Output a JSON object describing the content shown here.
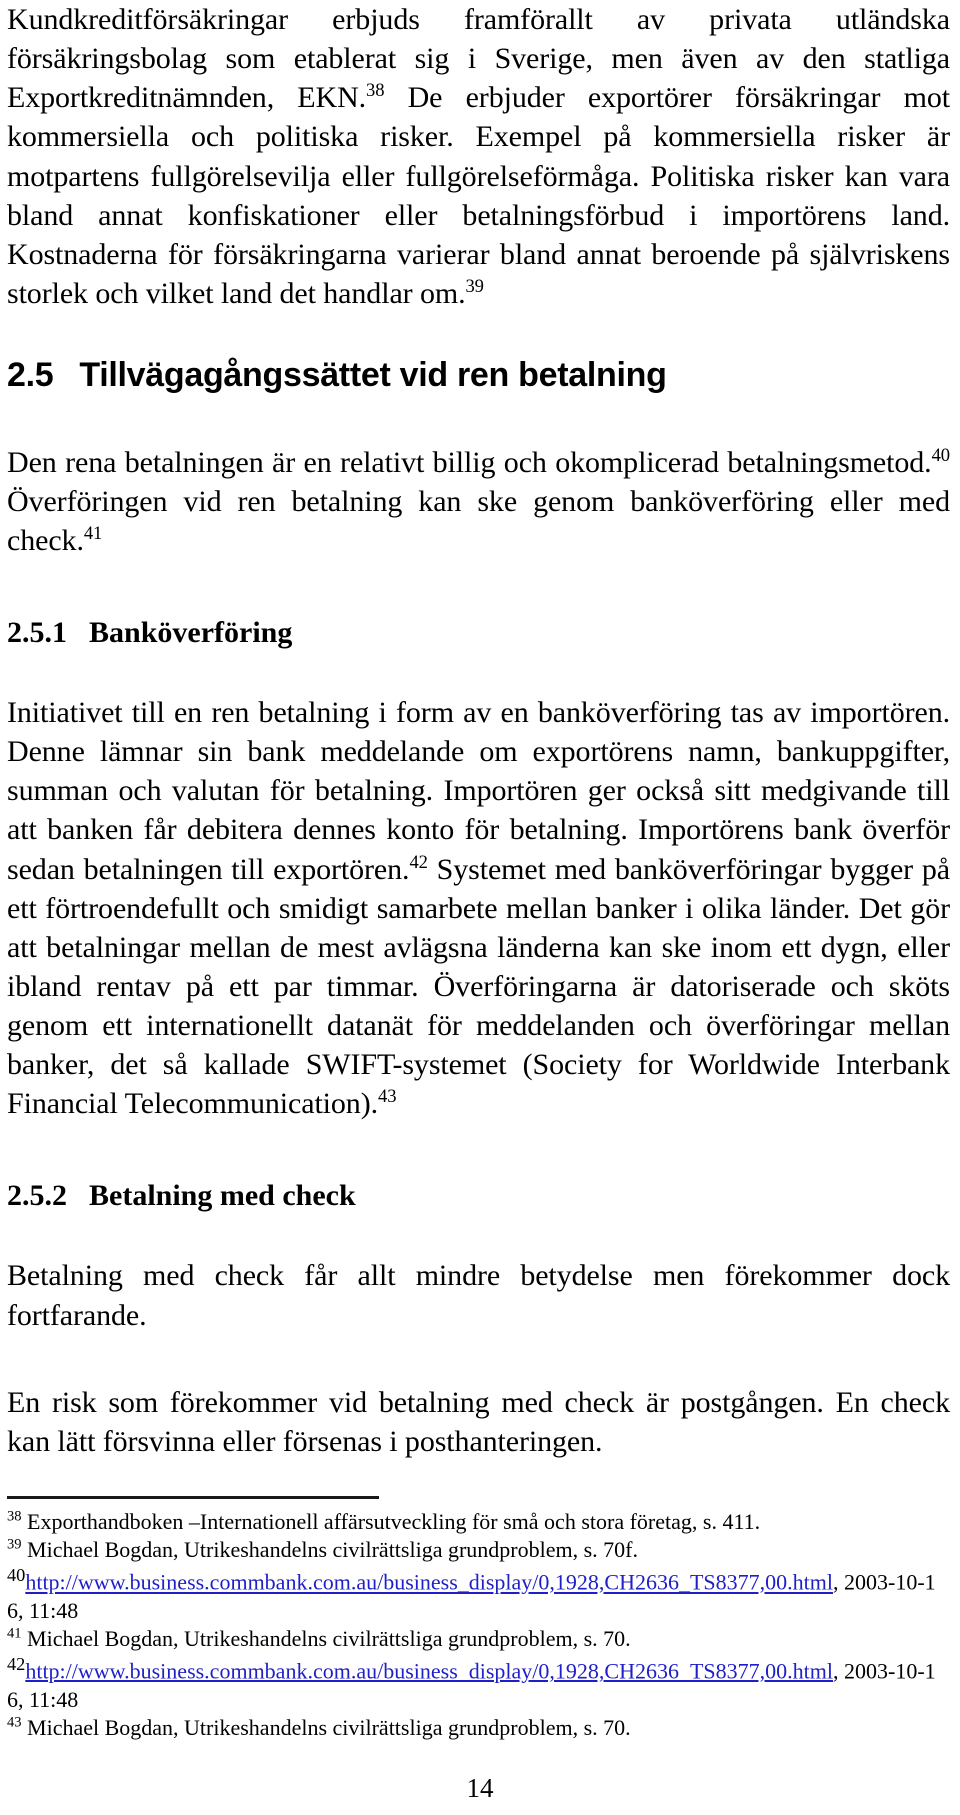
{
  "document": {
    "language": "sv",
    "page_number": "14"
  },
  "paragraphs": {
    "p1": {
      "text_before_ref1": "Kundkreditförsäkringar erbjuds framförallt av privata utländska försäkringsbolag som etablerat sig i Sverige, men även av den statliga Exportkreditnämnden, EKN.",
      "ref1": "38",
      "text_after_ref1": " De erbjuder exportörer försäkringar mot kommersiella och politiska risker. Exempel på kommersiella risker är motpartens fullgörelsevilja eller fullgörelseförmåga. Politiska risker kan vara bland annat konfiskationer eller betalningsförbud i importörens land. Kostnaderna för försäkringarna varierar bland annat beroende på självriskens storlek och vilket land det handlar om.",
      "ref2": "39"
    },
    "p2": {
      "text_before_ref1": "Den rena betalningen är en relativt billig och okomplicerad betalningsmetod.",
      "ref1": "40",
      "text_after_ref1": " Överföringen vid ren betalning kan ske genom banköverföring eller med check.",
      "ref2": "41"
    },
    "p3": {
      "text_before_ref1": "Initiativet till en ren betalning i form av en banköverföring tas av importören. Denne lämnar sin bank meddelande om exportörens namn, bankuppgifter, summan och valutan för betalning. Importören ger också sitt medgivande till att banken får debitera dennes konto för betalning. Importörens bank överför sedan betalningen till exportören.",
      "ref1": "42",
      "text_after_ref1": " Systemet med banköverföringar bygger på ett förtroendefullt och smidigt samarbete mellan banker i olika länder. Det gör att betalningar mellan de mest avlägsna länderna kan ske inom ett dygn, eller ibland rentav på ett par timmar. Överföringarna är datoriserade och sköts genom ett internationellt datanät för meddelanden och överföringar mellan banker, det så kallade SWIFT-systemet (Society for Worldwide Interbank Financial Telecommunication).",
      "ref2": "43"
    },
    "p4": {
      "text": "Betalning med check får allt mindre betydelse men förekommer dock fortfarande."
    },
    "p5": {
      "text": "En risk som förekommer vid betalning med check är postgången. En check kan lätt försvinna eller försenas i posthanteringen."
    }
  },
  "headings": {
    "h25": {
      "number": "2.5",
      "title": "Tillvägagångssättet vid ren betalning"
    },
    "h251": {
      "number": "2.5.1",
      "title": "Banköverföring"
    },
    "h252": {
      "number": "2.5.2",
      "title": "Betalning med check"
    }
  },
  "footnotes": [
    {
      "marker": "38",
      "text": "Exporthandboken –Internationell affärsutveckling för små och stora företag, s. 411.",
      "type": "text"
    },
    {
      "marker": "39",
      "text": "Michael Bogdan, Utrikeshandelns civilrättsliga grundproblem, s. 70f.",
      "type": "text"
    },
    {
      "marker": "40",
      "url": "http://www.business.commbank.com.au/business_display/0,1928,CH2636_TS8377,00.html",
      "suffix": ", 2003-10-16, 11:48",
      "type": "link"
    },
    {
      "marker": "41",
      "text": "Michael Bogdan, Utrikeshandelns civilrättsliga grundproblem, s. 70.",
      "type": "text"
    },
    {
      "marker": "42",
      "url": "http://www.business.commbank.com.au/business_display/0,1928,CH2636_TS8377,00.html",
      "suffix": ", 2003-10-16, 11:48",
      "type": "link"
    },
    {
      "marker": "43",
      "text": "Michael Bogdan, Utrikeshandelns civilrättsliga grundproblem, s. 70.",
      "type": "text"
    }
  ],
  "colors": {
    "link": "#1f1fc8",
    "text": "#000000",
    "rule": "#1a1a1a"
  }
}
